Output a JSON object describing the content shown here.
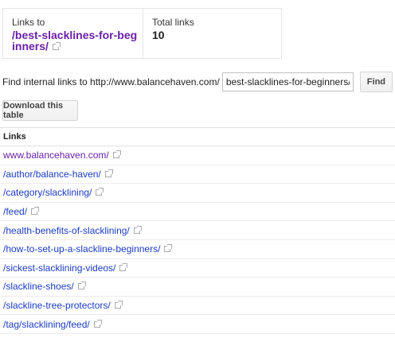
{
  "summary": {
    "links_to_caption": "Links to",
    "links_to_line1": "/best-slacklines-for-beg",
    "links_to_line2": "inners/",
    "total_caption": "Total links",
    "total_value": "10"
  },
  "find": {
    "label": "Find internal links to http://www.balancehaven.com/",
    "input_value": "best-slacklines-for-beginners/",
    "button_label": "Find"
  },
  "download": {
    "button_label": "Download this table"
  },
  "table": {
    "header": "Links",
    "rows": [
      "www.balancehaven.com/",
      "/author/balance-haven/",
      "/category/slacklining/",
      "/feed/",
      "/health-benefits-of-slacklining/",
      "/how-to-set-up-a-slackline-beginners/",
      "/sickest-slacklining-videos/",
      "/slackline-shoes/",
      "/slackline-tree-protectors/",
      "/tag/slacklining/feed/"
    ]
  },
  "colors": {
    "link": "#1a3cc4",
    "visited": "#6a1fa8"
  },
  "icons": {
    "external": "external-link-icon"
  }
}
